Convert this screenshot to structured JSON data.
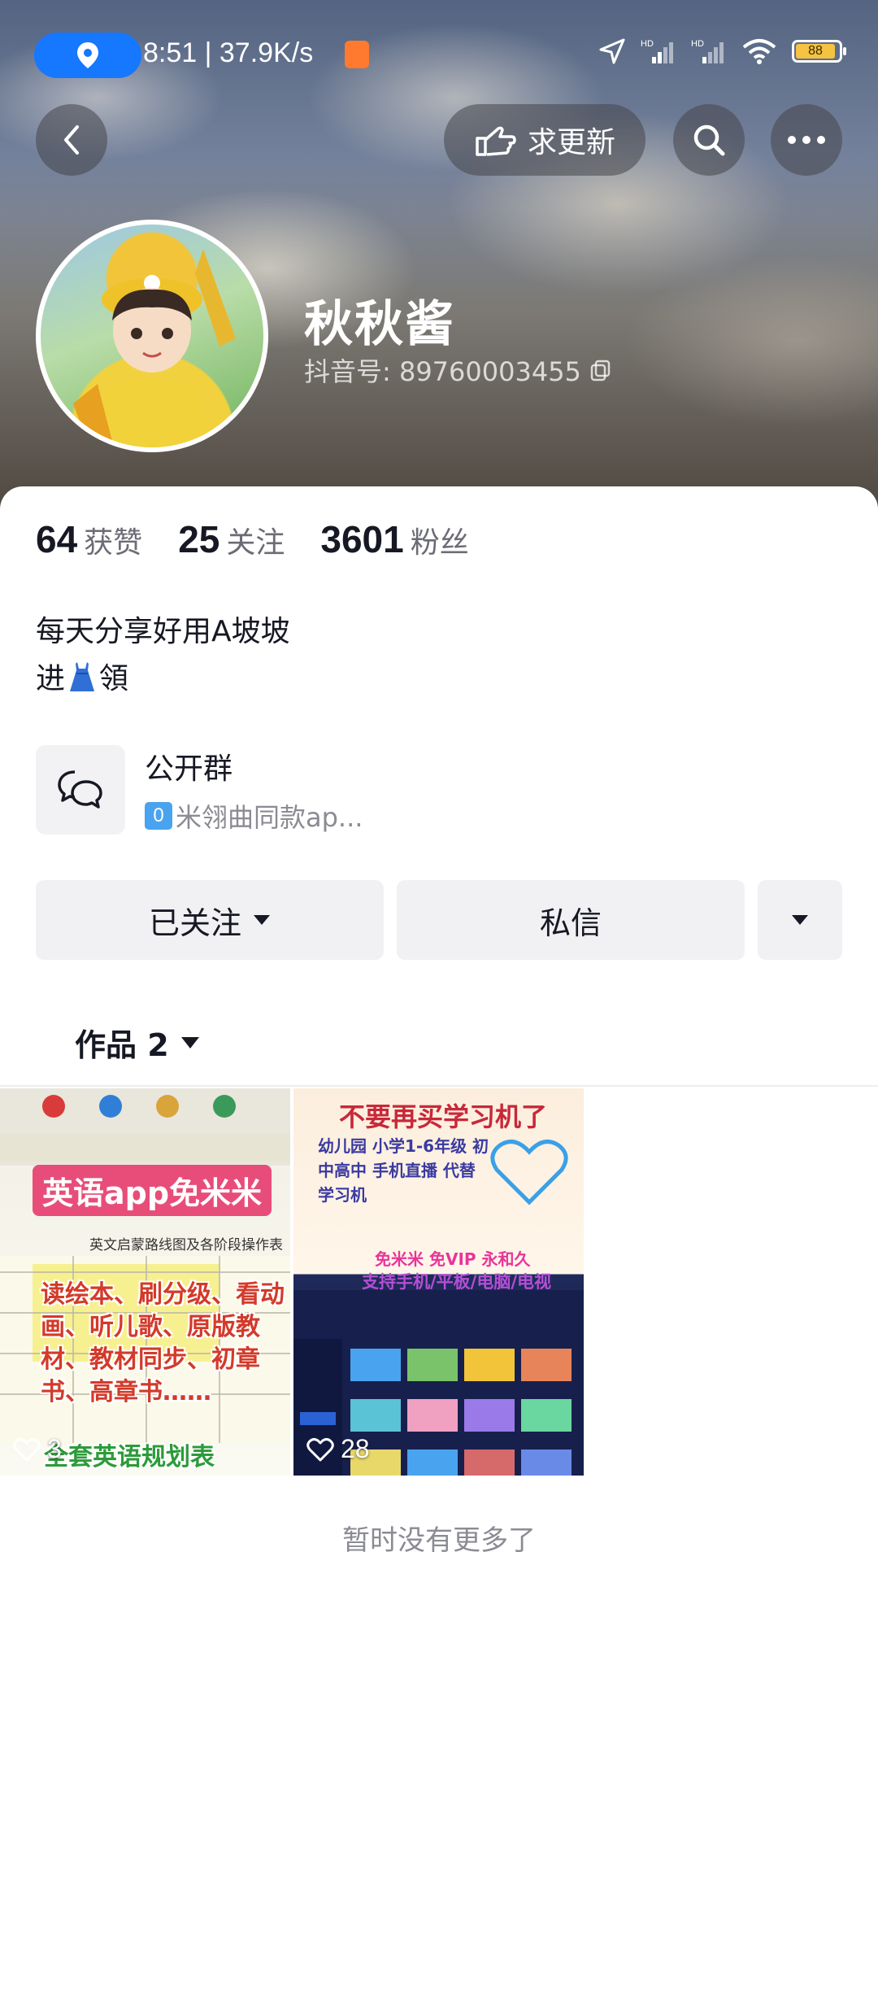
{
  "status_bar": {
    "time_speed": "8:51 | 37.9K/s",
    "battery": "88"
  },
  "top_bar": {
    "request_update_label": "求更新"
  },
  "profile": {
    "name": "秋秋酱",
    "douyin_id": "抖音号: 89760003455"
  },
  "stats": [
    {
      "value": "64",
      "label": "获赞"
    },
    {
      "value": "25",
      "label": "关注"
    },
    {
      "value": "3601",
      "label": "粉丝"
    }
  ],
  "bio": {
    "line1": "每天分享好用A坡坡",
    "line2_prefix": "进",
    "line2_suffix": "領"
  },
  "group": {
    "title": "公开群",
    "zero_badge": "0",
    "subtitle": "米翎曲同款ap..."
  },
  "actions": {
    "follow_label": "已关注",
    "message_label": "私信"
  },
  "works": {
    "tab_label": "作品 2"
  },
  "videos": [
    {
      "overlay_title": "英语app免米米",
      "overlay_sub": "英文启蒙路线图及各阶段操作表",
      "overlay_body": "读绘本、刷分级、看动画、听儿歌、原版教材、教材同步、初章书、高章书……",
      "overlay_bottom": "全套英语规划表",
      "likes": "3"
    },
    {
      "overlay_title": "不要再买学习机了",
      "overlay_sub": "幼儿园 小学1-6年级 初中高中 手机直播 代替 学习机",
      "overlay_body": "免米米 免VIP 永和久",
      "overlay_bottom": "支持手机/平板/电脑/电视",
      "likes": "28"
    }
  ],
  "footer": {
    "no_more": "暂时没有更多了"
  },
  "colors": {
    "accent_blue": "#1677ff",
    "button_bg": "#f1f1f3",
    "muted_text": "#8a8b93"
  }
}
